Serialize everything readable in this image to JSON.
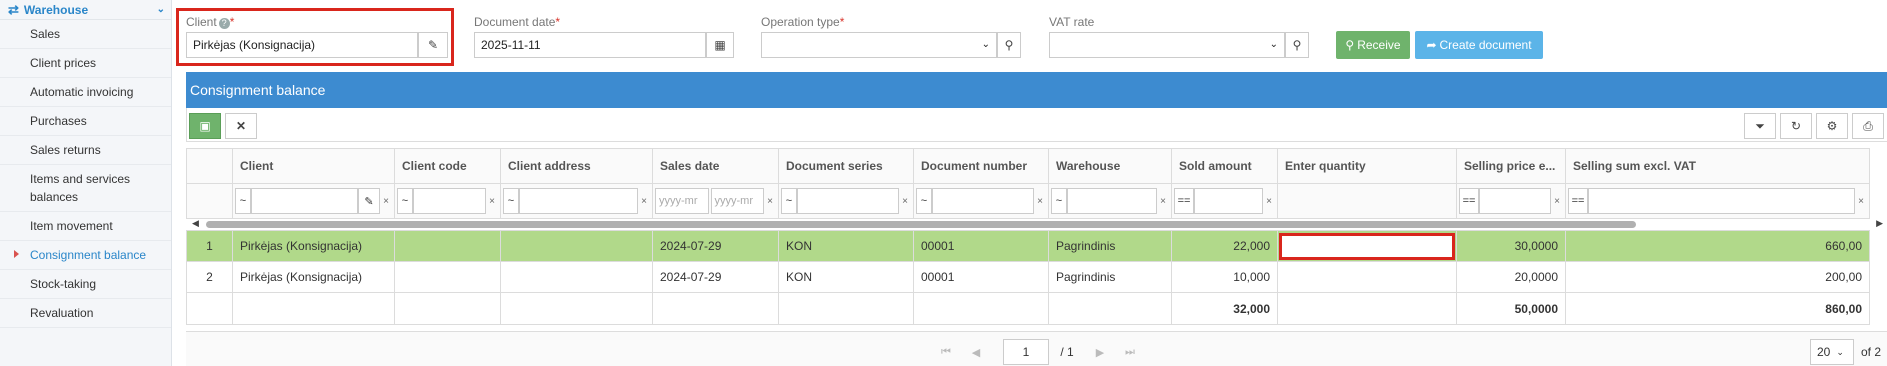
{
  "sidebar": {
    "section": "Warehouse",
    "items": [
      {
        "label": "Sales"
      },
      {
        "label": "Client prices"
      },
      {
        "label": "Automatic invoicing"
      },
      {
        "label": "Purchases"
      },
      {
        "label": "Sales returns"
      },
      {
        "label": "Items and services balances"
      },
      {
        "label": "Item movement"
      },
      {
        "label": "Consignment balance"
      },
      {
        "label": "Stock-taking"
      },
      {
        "label": "Revaluation"
      }
    ]
  },
  "form": {
    "client_label": "Client",
    "client_value": "Pirkėjas (Konsignacija)",
    "date_label": "Document date",
    "date_value": "2025-11-11",
    "operation_label": "Operation type",
    "operation_value": "",
    "vat_label": "VAT rate",
    "vat_value": "",
    "required_mark": "*",
    "help_mark": "?"
  },
  "buttons": {
    "receive": "Receive",
    "create": "Create document"
  },
  "colors": {
    "accent": "#3d8bd0",
    "receive_bg": "#6fb36c",
    "create_bg": "#5bb4e8",
    "selected_row": "#b1d98a",
    "highlight": "#d9261c"
  },
  "grid": {
    "title": "Consignment balance",
    "columns": [
      "",
      "Client",
      "Client code",
      "Client address",
      "Sales date",
      "Document series",
      "Document number",
      "Warehouse",
      "Sold amount",
      "Enter quantity",
      "Selling price e...",
      "Selling sum excl. VAT"
    ],
    "filters": {
      "tilde": "~",
      "eq": "==",
      "date_placeholder": "yyyy-mr",
      "clear": "×"
    },
    "rows": [
      {
        "no": "1",
        "client": "Pirkėjas (Konsignacija)",
        "client_code": "",
        "client_address": "",
        "sales_date": "2024-07-29",
        "series": "KON",
        "number": "00001",
        "warehouse": "Pagrindinis",
        "sold": "22,000",
        "qty": "",
        "price": "30,0000",
        "sum": "660,00"
      },
      {
        "no": "2",
        "client": "Pirkėjas (Konsignacija)",
        "client_code": "",
        "client_address": "",
        "sales_date": "2024-07-29",
        "series": "KON",
        "number": "00001",
        "warehouse": "Pagrindinis",
        "sold": "10,000",
        "qty": "",
        "price": "20,0000",
        "sum": "200,00"
      }
    ],
    "totals": {
      "sold": "32,000",
      "price": "50,0000",
      "sum": "860,00"
    }
  },
  "pager": {
    "page": "1",
    "of_pages": "/ 1",
    "page_size": "20",
    "of_total": "of 2"
  }
}
